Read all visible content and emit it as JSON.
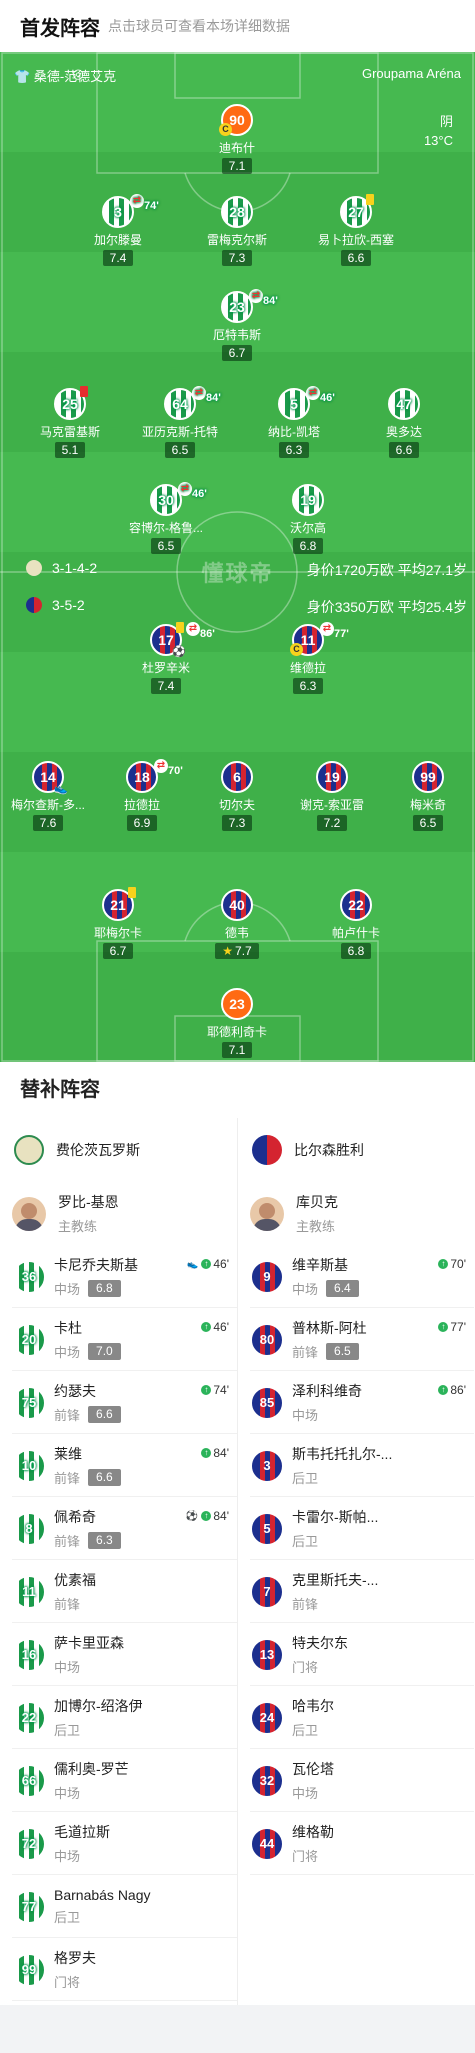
{
  "header": {
    "title": "首发阵容",
    "subtitle": "点击球员可查看本场详细数据"
  },
  "pitch": {
    "home_team": "桑德-范德艾克",
    "venue": "Groupama Aréna",
    "weather": "阴",
    "temperature": "13°C",
    "watermark": "懂球帝",
    "home_formation": "3-1-4-2",
    "home_value": "身价1720万欧 平均27.1岁",
    "away_formation": "3-5-2",
    "away_value": "身价3350万欧 平均25.4岁"
  },
  "home_players": [
    {
      "num": "90",
      "name": "迪布什",
      "rating": "7.1",
      "keeper": true,
      "captain": true
    },
    {
      "num": "3",
      "name": "加尔滕曼",
      "rating": "7.4",
      "sub_out": "74'"
    },
    {
      "num": "28",
      "name": "雷梅克尔斯",
      "rating": "7.3"
    },
    {
      "num": "27",
      "name": "易卜拉欣-西塞",
      "rating": "6.6",
      "yellow": true
    },
    {
      "num": "23",
      "name": "厄特韦斯",
      "rating": "6.7",
      "sub_out": "84'"
    },
    {
      "num": "25",
      "name": "马克雷基斯",
      "rating": "5.1",
      "red": true
    },
    {
      "num": "64",
      "name": "亚历克斯-托特",
      "rating": "6.5",
      "sub_out": "84'"
    },
    {
      "num": "5",
      "name": "纳比-凯塔",
      "rating": "6.3",
      "sub_out": "46'"
    },
    {
      "num": "47",
      "name": "奥多达",
      "rating": "6.6"
    },
    {
      "num": "30",
      "name": "容博尔-格鲁...",
      "rating": "6.5",
      "sub_out": "46'"
    },
    {
      "num": "19",
      "name": "沃尔高",
      "rating": "6.8"
    }
  ],
  "away_players": [
    {
      "num": "17",
      "name": "杜罗辛米",
      "rating": "7.4",
      "sub_out": "86'",
      "yellow": true,
      "goal": true
    },
    {
      "num": "11",
      "name": "维德拉",
      "rating": "6.3",
      "sub_out": "77'",
      "captain": true
    },
    {
      "num": "14",
      "name": "梅尔查斯-多...",
      "rating": "7.6",
      "assist": true
    },
    {
      "num": "18",
      "name": "拉德拉",
      "rating": "6.9",
      "sub_out": "70'"
    },
    {
      "num": "6",
      "name": "切尔夫",
      "rating": "7.3"
    },
    {
      "num": "19",
      "name": "谢克-索亚雷",
      "rating": "7.2"
    },
    {
      "num": "99",
      "name": "梅米奇",
      "rating": "6.5"
    },
    {
      "num": "21",
      "name": "耶梅尔卡",
      "rating": "6.7",
      "yellow": true
    },
    {
      "num": "40",
      "name": "德韦",
      "rating": "7.7",
      "best": true
    },
    {
      "num": "22",
      "name": "帕卢什卡",
      "rating": "6.8"
    },
    {
      "num": "23",
      "name": "耶德利奇卡",
      "rating": "7.1",
      "keeper": true
    }
  ],
  "subs": {
    "title": "替补阵容",
    "home": {
      "team": "费伦茨瓦罗斯",
      "coach": {
        "name": "罗比-基恩",
        "role": "主教练"
      },
      "players": [
        {
          "num": "36",
          "name": "卡尼乔夫斯基",
          "pos": "中场",
          "rating": "6.8",
          "time": "46'",
          "assist": true
        },
        {
          "num": "20",
          "name": "卡杜",
          "pos": "中场",
          "rating": "7.0",
          "time": "46'"
        },
        {
          "num": "75",
          "name": "约瑟夫",
          "pos": "前锋",
          "rating": "6.6",
          "time": "74'"
        },
        {
          "num": "10",
          "name": "莱维",
          "pos": "前锋",
          "rating": "6.6",
          "time": "84'"
        },
        {
          "num": "8",
          "name": "佩希奇",
          "pos": "前锋",
          "rating": "6.3",
          "time": "84'",
          "goal": true
        },
        {
          "num": "11",
          "name": "优素福",
          "pos": "前锋"
        },
        {
          "num": "16",
          "name": "萨卡里亚森",
          "pos": "中场"
        },
        {
          "num": "22",
          "name": "加博尔-绍洛伊",
          "pos": "后卫"
        },
        {
          "num": "66",
          "name": "儒利奥-罗芒",
          "pos": "中场"
        },
        {
          "num": "72",
          "name": "毛道拉斯",
          "pos": "中场"
        },
        {
          "num": "77",
          "name": "Barnabás Nagy",
          "pos": "后卫"
        },
        {
          "num": "99",
          "name": "格罗夫",
          "pos": "门将"
        }
      ]
    },
    "away": {
      "team": "比尔森胜利",
      "coach": {
        "name": "库贝克",
        "role": "主教练"
      },
      "players": [
        {
          "num": "9",
          "name": "维辛斯基",
          "pos": "中场",
          "rating": "6.4",
          "time": "70'"
        },
        {
          "num": "80",
          "name": "普林斯-阿杜",
          "pos": "前锋",
          "rating": "6.5",
          "time": "77'"
        },
        {
          "num": "85",
          "name": "泽利科维奇",
          "pos": "中场",
          "time": "86'"
        },
        {
          "num": "3",
          "name": "斯韦托托扎尔-...",
          "pos": "后卫"
        },
        {
          "num": "5",
          "name": "卡雷尔-斯帕...",
          "pos": "后卫"
        },
        {
          "num": "7",
          "name": "克里斯托夫-...",
          "pos": "前锋"
        },
        {
          "num": "13",
          "name": "特夫尔东",
          "pos": "门将"
        },
        {
          "num": "24",
          "name": "哈韦尔",
          "pos": "后卫"
        },
        {
          "num": "32",
          "name": "瓦伦塔",
          "pos": "中场"
        },
        {
          "num": "44",
          "name": "维格勒",
          "pos": "门将"
        }
      ]
    }
  }
}
